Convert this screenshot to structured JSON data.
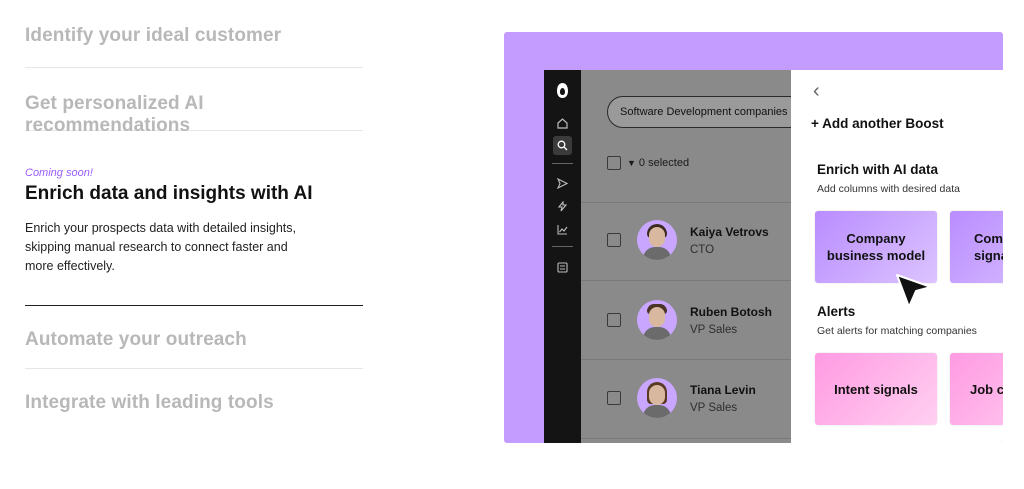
{
  "features": {
    "item1": "Identify your ideal customer",
    "item2": "Get personalized AI recommendations",
    "active": {
      "badge": "Coming soon!",
      "title": "Enrich data and insights with AI",
      "description": "Enrich your prospects data with detailed insights, skipping manual research to connect faster and more effectively."
    },
    "item4": "Automate your outreach",
    "item5": "Integrate with leading tools"
  },
  "preview": {
    "colors": {
      "accent_bg": "#c49bff",
      "card_purple": "#b98cff",
      "card_pink": "#ff9ae2"
    },
    "sidebar_icons": [
      "logo-icon",
      "home-icon",
      "search-icon",
      "send-icon",
      "sparkle-icon",
      "chart-icon",
      "list-icon"
    ],
    "list": {
      "search_value": "Software Development companies",
      "selected_label": "0 selected",
      "people": [
        {
          "name": "Kaiya Vetrovs",
          "role": "CTO"
        },
        {
          "name": "Ruben Botosh",
          "role": "VP Sales"
        },
        {
          "name": "Tiana Levin",
          "role": "VP Sales"
        }
      ]
    },
    "panel": {
      "add_boost": "+ Add another Boost",
      "enrich_title": "Enrich with AI data",
      "enrich_sub": "Add columns with desired data",
      "enrich_cards": [
        "Company business model",
        "Company signals"
      ],
      "alerts_title": "Alerts",
      "alerts_sub": "Get alerts for matching companies",
      "alert_cards": [
        "Intent signals",
        "Job changes"
      ]
    }
  }
}
